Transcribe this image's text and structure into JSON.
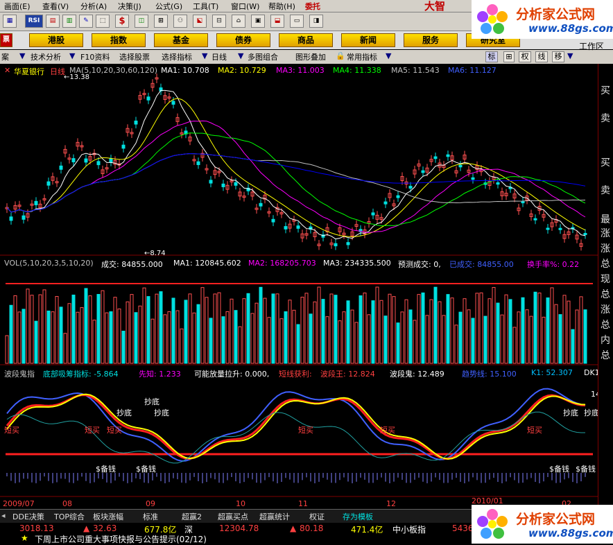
{
  "menu": [
    "画面(E)",
    "查看(V)",
    "分析(A)",
    "决策(J)",
    "公式(G)",
    "工具(T)",
    "窗口(W)",
    "帮助(H)"
  ],
  "menu_extra": "委托",
  "brand_partial": "大智",
  "logo": {
    "title": "分析家公式网",
    "url": "www.88gs.com"
  },
  "navbuttons": [
    "港股",
    "指数",
    "基金",
    "债券",
    "商品",
    "新闻",
    "服务",
    "研究室"
  ],
  "subbar": {
    "left_cut": "案",
    "items": [
      "技术分析",
      "F10资料",
      "选择股票",
      "选择指标",
      "日线",
      "多图组合",
      "图形叠加",
      "常用指标"
    ],
    "right": [
      "标",
      "权",
      "线",
      "移"
    ],
    "work": "工作区"
  },
  "price_header": {
    "stock": "华夏银行",
    "period": "日线",
    "ma_label": "MA(5,10,20,30,60,120)",
    "ma1": "MA1: 10.708",
    "ma2": "MA2: 10.729",
    "ma3": "MA3: 11.003",
    "ma4": "MA4: 11.338",
    "ma5": "MA5: 11.543",
    "ma6": "MA6: 11.127"
  },
  "price_marks": {
    "high": "13.38",
    "low": "8.74"
  },
  "vol_header": {
    "label": "VOL(5,10,20,3,5,10,20)",
    "vol": "成交: 84855.000",
    "ma1": "MA1: 120845.602",
    "ma2": "MA2: 168205.703",
    "ma3": "MA3: 234335.500",
    "forecast": "预测成交: 0,",
    "bought": "已成交: 84855.00",
    "turnover": "换手率%: 0.22"
  },
  "ind_header": {
    "name": "波段鬼指",
    "i1": "底部吸筹指标: -5.864",
    "i2": "先知: 1.233",
    "i3": "可能放量拉升: 0.000,",
    "i4": "短线获利: ",
    "i5": "波段王: 12.824",
    "i6": "波段鬼: 12.489",
    "i7": "趋势线: 15.100",
    "i8": "K1: 52.307",
    "i9": "DK1"
  },
  "signals": {
    "buy": "短买",
    "bottom": "抄底",
    "reserve": "$备钱",
    "right_top": "14"
  },
  "xaxis": [
    "2009/07",
    "08",
    "09",
    "10",
    "11",
    "12",
    "2010/01",
    "02"
  ],
  "rightcol": [
    "买",
    "卖",
    "买",
    "卖",
    "最",
    "涨",
    "涨",
    "总",
    "现",
    "总",
    "涨",
    "总",
    "内",
    "总"
  ],
  "bottomtabs": [
    "DDE决策",
    "TOP综合",
    "板块涨幅",
    "标准",
    "超赢2",
    "超赢买点",
    "超赢统计",
    "权证",
    "存为模板"
  ],
  "ticker": {
    "v1": "3018.13",
    "c1": "32.63",
    "a1": "677.8亿",
    "name2": "深",
    "v2": "12304.78",
    "c2": "80.18",
    "a2": "471.4亿",
    "name3": "中小板指",
    "v3": "5436"
  },
  "news": "下周上市公司重大事项快报与公告提示(02/12)",
  "colors": {
    "ma1": "#ffffff",
    "ma2": "#ffff00",
    "ma3": "#ff00ff",
    "ma4": "#00ff00",
    "ma5": "#c0c0c0",
    "ma6": "#0000ff",
    "up": "#ff5050",
    "down": "#00e0e0"
  }
}
